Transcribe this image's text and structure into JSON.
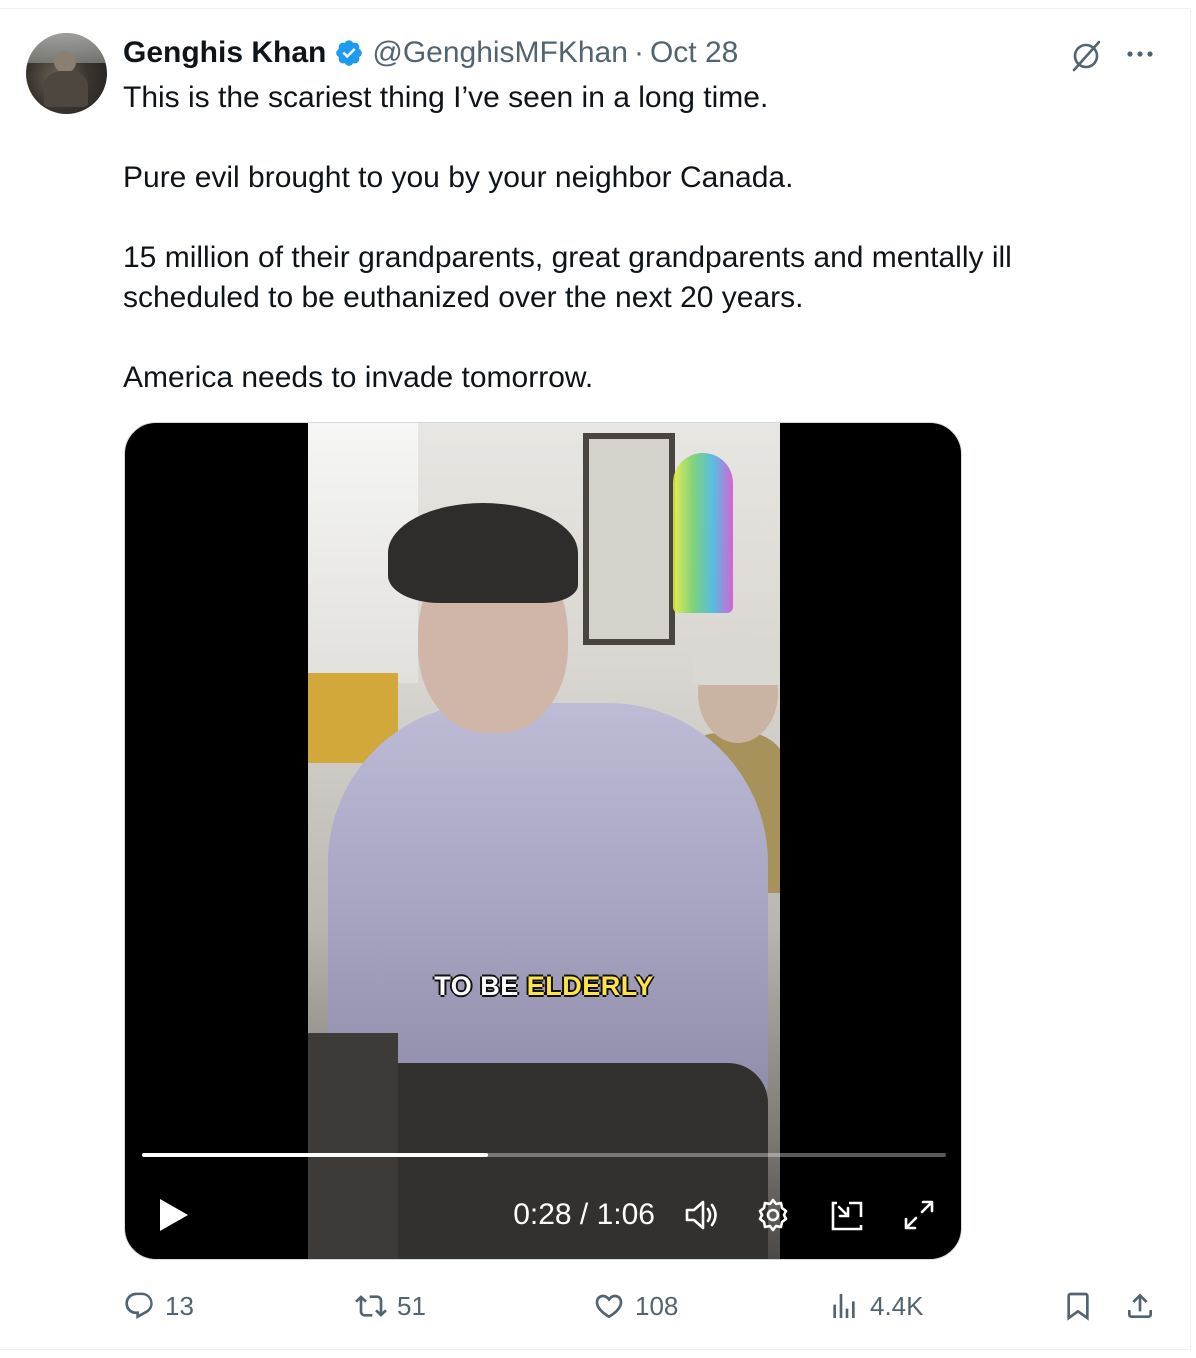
{
  "author": {
    "name": "Genghis Khan",
    "handle": "@GenghisMFKhan",
    "separator": "·",
    "date": "Oct 28"
  },
  "tweet": {
    "paragraphs": [
      "This is the scariest thing I’ve seen in a long time.",
      "Pure evil brought to you by your neighbor Canada.",
      "15 million of their grandparents, great grandparents and mentally ill scheduled to be euthanized over the next 20 years.",
      "America needs to invade tomorrow."
    ]
  },
  "video": {
    "caption_white": "TO BE",
    "caption_yellow": "ELDERLY",
    "time": "0:28 / 1:06",
    "progress": 0.43
  },
  "actions": {
    "replies": "13",
    "reposts": "51",
    "likes": "108",
    "views": "4.4K"
  },
  "icons": {
    "grok": "grok-icon",
    "more": "more-icon",
    "reply": "reply-icon",
    "repost": "repost-icon",
    "like": "like-icon",
    "views": "views-icon",
    "bookmark": "bookmark-icon",
    "share": "share-icon",
    "play": "play-icon",
    "volume": "volume-icon",
    "settings": "gear-icon",
    "pip": "minimize-icon",
    "fullscreen": "fullscreen-icon"
  },
  "colors": {
    "verified": "#1d9bf0",
    "secondary_text": "#536471",
    "caption_highlight": "#ffe34a"
  }
}
